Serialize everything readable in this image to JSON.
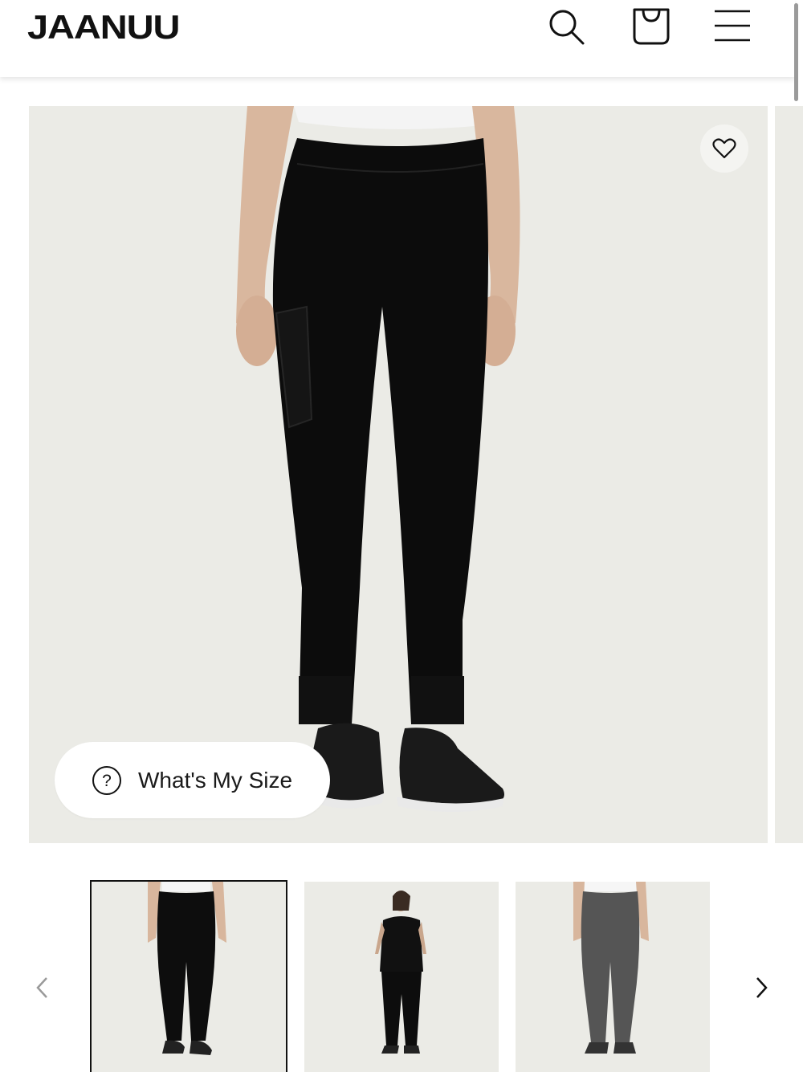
{
  "header": {
    "logo": "JAANUU",
    "icons": [
      "search-icon",
      "shopping-bag-icon",
      "menu-icon"
    ]
  },
  "hero": {
    "favorite_icon": "heart-icon",
    "size_button_label": "What's My Size",
    "size_button_icon": "question-circle-icon"
  },
  "colors": {
    "background": "#ffffff",
    "image_background": "#ebebe6",
    "pants_black": "#0c0c0c",
    "pants_grey": "#555555",
    "text": "#111111"
  },
  "thumbnails": [
    {
      "label": "black jogger front",
      "selected": true
    },
    {
      "label": "full outfit front",
      "selected": false
    },
    {
      "label": "grey jogger back",
      "selected": false
    }
  ],
  "carousel": {
    "prev_icon": "chevron-left-icon",
    "next_icon": "chevron-right-icon"
  }
}
